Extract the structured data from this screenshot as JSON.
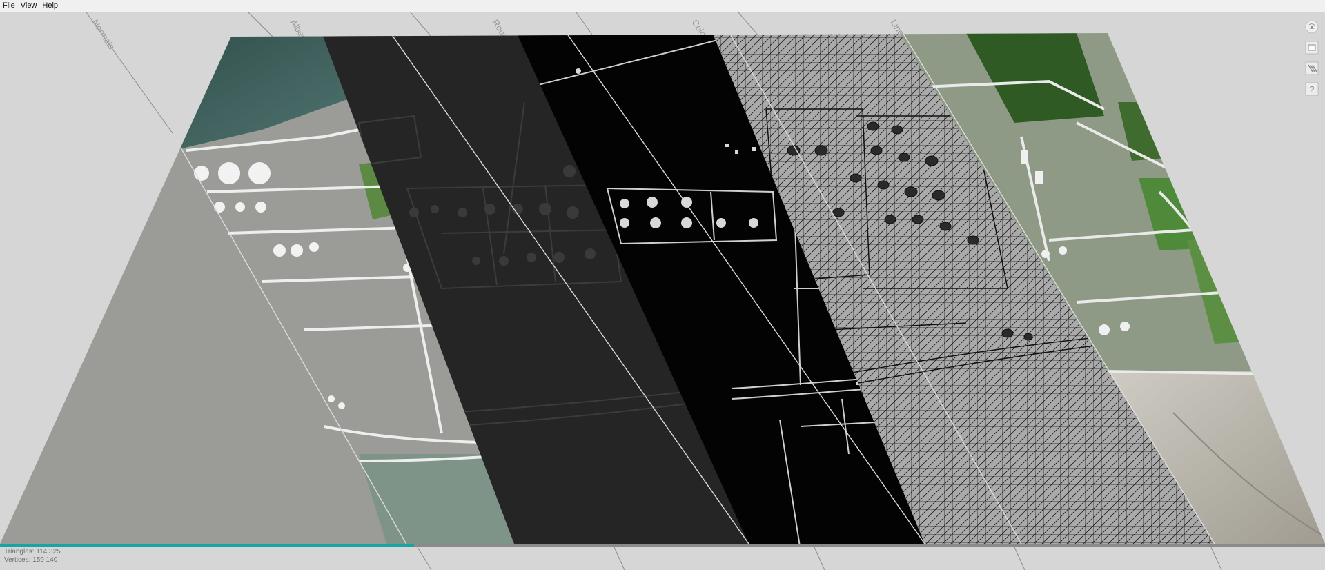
{
  "menu": {
    "items": [
      "File",
      "View",
      "Help"
    ]
  },
  "bands": [
    {
      "name": "Normals",
      "render": "normals"
    },
    {
      "name": "Albedo",
      "render": "albedo"
    },
    {
      "name": "Roughness",
      "render": "roughness"
    },
    {
      "name": "Colors",
      "render": "colors"
    },
    {
      "name": "Lines",
      "render": "lines"
    },
    {
      "name": "",
      "render": "albedo"
    }
  ],
  "stats": {
    "triangles": "Triangles: 114 325",
    "vertices": "Vertices: 159 140"
  },
  "toolbar": [
    {
      "name": "globe-icon-button"
    },
    {
      "name": "window-icon-button"
    },
    {
      "name": "lines-icon-button"
    },
    {
      "name": "help-icon-button",
      "glyph": "?"
    }
  ],
  "colors": {
    "background": "#d6d6d6",
    "normals": "#b4f7b8",
    "roughness": "#252525",
    "colors": "#030303",
    "lines_bg": "#aaaaaa",
    "road": "#e6e6e6",
    "grass": "#4f8a3a",
    "water": "#4e6b69",
    "mudflat": "#b5b1a8",
    "accent": "#1aa3a3"
  }
}
